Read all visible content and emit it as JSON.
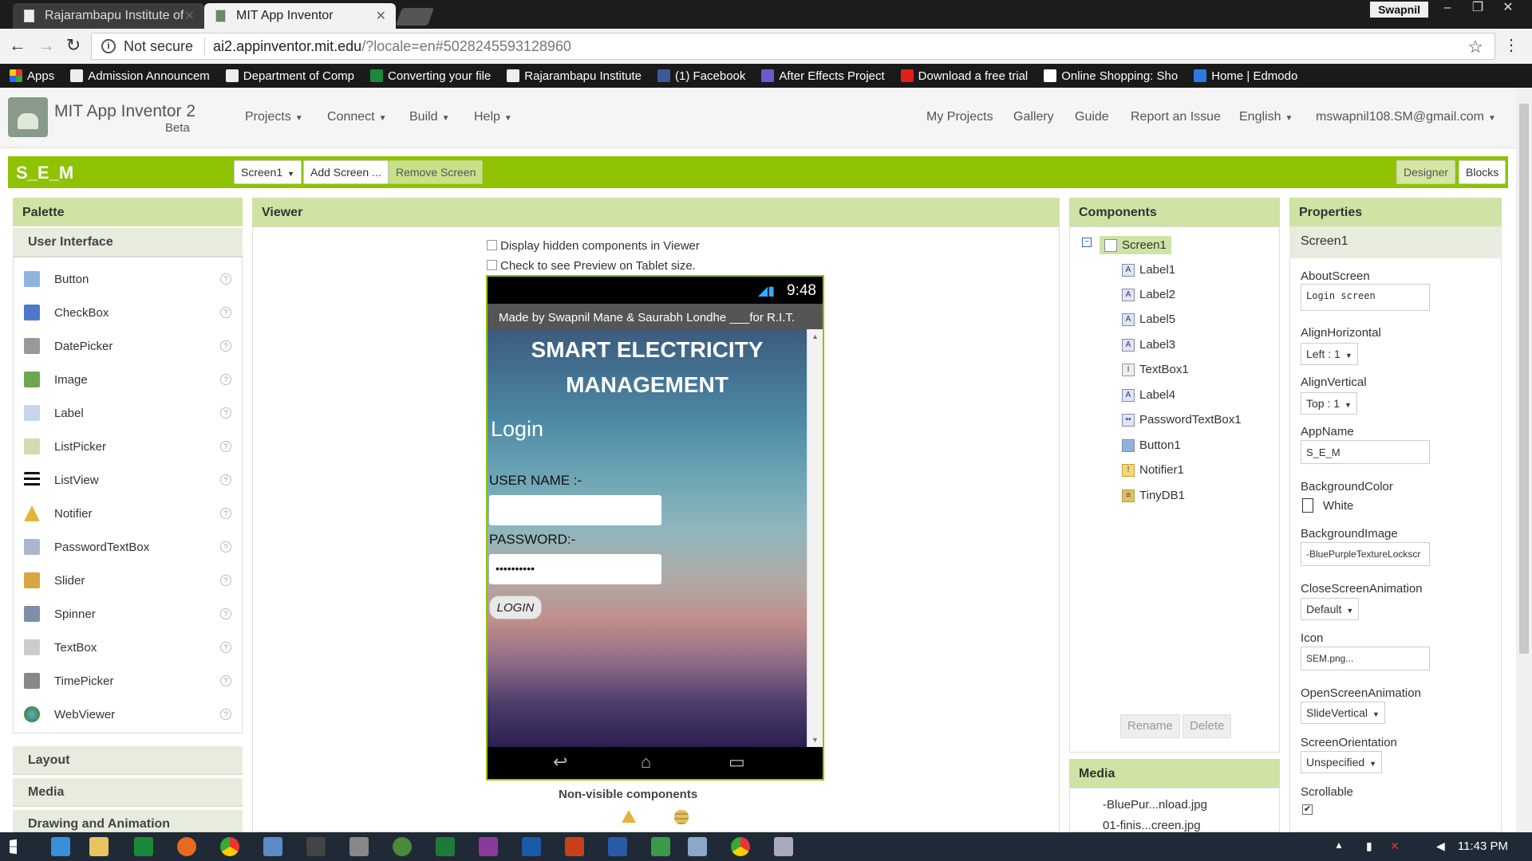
{
  "browser": {
    "tabs": [
      {
        "label": "Rajarambapu Institute of"
      },
      {
        "label": "MIT App Inventor"
      }
    ],
    "user": "Swapnil",
    "not_secure": "Not secure",
    "url_host": "ai2.appinventor.mit.edu",
    "url_rest": "/?locale=en#5028245593128960",
    "apps_label": "Apps",
    "bookmarks": [
      {
        "label": "Admission Announcem",
        "icon": "doc-icon"
      },
      {
        "label": "Department of Comp",
        "icon": "doc-icon"
      },
      {
        "label": "Converting your file",
        "icon": "convert-icon"
      },
      {
        "label": "Rajarambapu Institute",
        "icon": "doc-icon"
      },
      {
        "label": "(1) Facebook",
        "icon": "facebook-icon"
      },
      {
        "label": "After Effects Project",
        "icon": "ae-icon"
      },
      {
        "label": "Download a free trial",
        "icon": "adobe-icon"
      },
      {
        "label": "Online Shopping: Sho",
        "icon": "amazon-icon"
      },
      {
        "label": "Home | Edmodo",
        "icon": "edmodo-icon"
      }
    ]
  },
  "app": {
    "title": "MIT App Inventor 2",
    "beta": "Beta",
    "menus": [
      "Projects",
      "Connect",
      "Build",
      "Help"
    ],
    "right_links": [
      "My Projects",
      "Gallery",
      "Guide",
      "Report an Issue",
      "English",
      "mswapnil108.SM@gmail.com"
    ]
  },
  "project": {
    "name": "S_E_M",
    "screen_select": "Screen1",
    "add_screen": "Add Screen ...",
    "remove_screen": "Remove Screen",
    "designer": "Designer",
    "blocks": "Blocks"
  },
  "palette": {
    "header": "Palette",
    "section_user_interface": "User Interface",
    "items": [
      {
        "label": "Button",
        "color": "#8fb3e0"
      },
      {
        "label": "CheckBox",
        "color": "#4a7bc8"
      },
      {
        "label": "DatePicker",
        "color": "#999999"
      },
      {
        "label": "Image",
        "color": "#6aa84f"
      },
      {
        "label": "Label",
        "color": "#c9d6ea"
      },
      {
        "label": "ListPicker",
        "color": "#d9d9b0"
      },
      {
        "label": "ListView",
        "color": "#111111"
      },
      {
        "label": "Notifier",
        "color": "#e6b33a"
      },
      {
        "label": "PasswordTextBox",
        "color": "#a9b8d0"
      },
      {
        "label": "Slider",
        "color": "#d9a441"
      },
      {
        "label": "Spinner",
        "color": "#7b8fa8"
      },
      {
        "label": "TextBox",
        "color": "#cccccc"
      },
      {
        "label": "TimePicker",
        "color": "#888888"
      },
      {
        "label": "WebViewer",
        "color": "#3a8a4a"
      }
    ],
    "section_layout": "Layout",
    "section_media": "Media",
    "section_drawing": "Drawing and Animation",
    "help_glyph": "?"
  },
  "viewer": {
    "header": "Viewer",
    "opt_hidden": "Display hidden components in Viewer",
    "opt_tablet": "Check to see Preview on Tablet size.",
    "phone_time": "9:48",
    "phone_title": "Made by Swapnil Mane & Saurabh Londhe ___for R.I.T.",
    "app_title_line1": "SMART ELECTRICITY",
    "app_title_line2": "MANAGEMENT",
    "login_heading": "Login",
    "username_label": "USER NAME :-",
    "password_label": "PASSWORD:-",
    "password_value": "••••••••••",
    "login_button": "LOGIN",
    "nonvisible_header": "Non-visible components"
  },
  "components": {
    "header": "Components",
    "root": "Screen1",
    "items": [
      {
        "label": "Label1",
        "icon": "A"
      },
      {
        "label": "Label2",
        "icon": "A"
      },
      {
        "label": "Label5",
        "icon": "A"
      },
      {
        "label": "Label3",
        "icon": "A"
      },
      {
        "label": "TextBox1",
        "icon": "I"
      },
      {
        "label": "Label4",
        "icon": "A"
      },
      {
        "label": "PasswordTextBox1",
        "icon": "••"
      },
      {
        "label": "Button1",
        "icon": ""
      },
      {
        "label": "Notifier1",
        "icon": "!"
      },
      {
        "label": "TinyDB1",
        "icon": "≡"
      }
    ],
    "rename": "Rename",
    "delete": "Delete"
  },
  "media": {
    "header": "Media",
    "items": [
      "-BluePur...nload.jpg",
      "01-finis...creen.jpg"
    ]
  },
  "properties": {
    "header": "Properties",
    "component": "Screen1",
    "about_label": "AboutScreen",
    "about_value": "Login screen",
    "alignh_label": "AlignHorizontal",
    "alignh_value": "Left : 1",
    "alignv_label": "AlignVertical",
    "alignv_value": "Top : 1",
    "appname_label": "AppName",
    "appname_value": "S_E_M",
    "bgcolor_label": "BackgroundColor",
    "bgcolor_value": "White",
    "bgimage_label": "BackgroundImage",
    "bgimage_value": "-BluePurpleTextureLockscr",
    "closeanim_label": "CloseScreenAnimation",
    "closeanim_value": "Default",
    "icon_label": "Icon",
    "icon_value": "SEM.png...",
    "openanim_label": "OpenScreenAnimation",
    "openanim_value": "SlideVertical",
    "orientation_label": "ScreenOrientation",
    "orientation_value": "Unspecified",
    "scrollable_label": "Scrollable"
  },
  "taskbar": {
    "time": "11:43 PM"
  },
  "colors": {
    "accent_green": "#8fc202",
    "panel_header": "#cfe3a4"
  }
}
